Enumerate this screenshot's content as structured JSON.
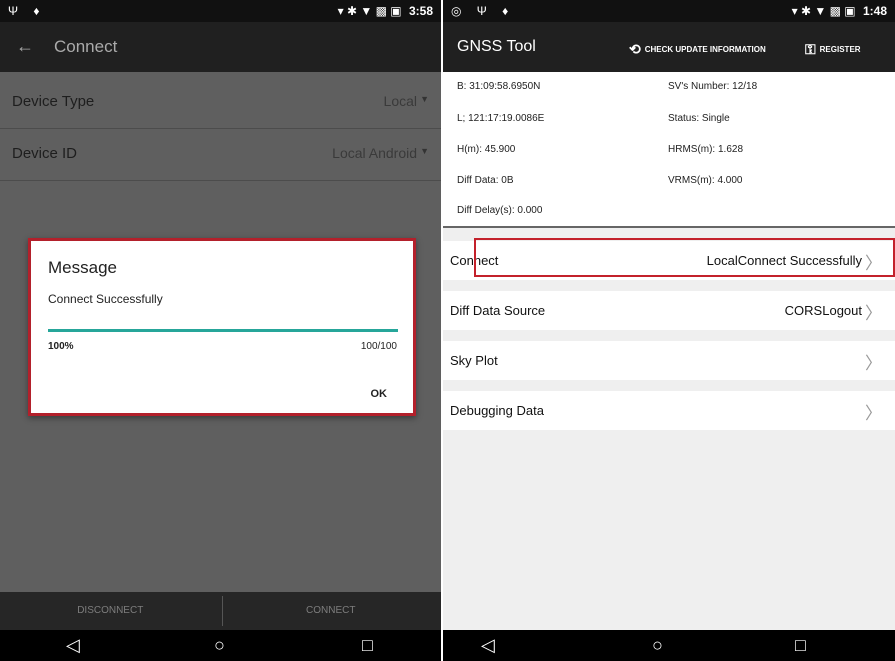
{
  "left": {
    "status_bar": {
      "left_icons": "Ψ ♦",
      "right_icons": "▾ ✱ ▼ ▩ ▣",
      "time": "3:58"
    },
    "app_bar": {
      "back_icon": "←",
      "title": "Connect"
    },
    "rows": [
      {
        "label": "Device Type",
        "value": "Local"
      },
      {
        "label": "Device ID",
        "value": "Local Android"
      }
    ],
    "dialog": {
      "title": "Message",
      "message": "Connect Successfully",
      "progress_fraction": 1.0,
      "percent": "100%",
      "count": "100/100",
      "ok_label": "OK"
    },
    "bottom_buttons": {
      "disconnect": "DISCONNECT",
      "connect": "CONNECT"
    }
  },
  "right": {
    "status_bar": {
      "left_icons": "◎ Ψ ♦",
      "right_icons": "▾ ✱ ▼ ▩ ▣",
      "time": "1:48"
    },
    "app_bar": {
      "title": "GNSS Tool",
      "check_update": "CHECK UPDATE INFORMATION",
      "register": "REGISTER"
    },
    "info": {
      "b": "B:   31:09:58.6950N",
      "l": "L;   121:17:19.0086E",
      "h": "H(m):   45.900",
      "diff_data": "Diff Data:  0B",
      "diff_delay": "Diff Delay(s):  0.000",
      "sv_number": "SV's Number:  12/18",
      "status": "Status:  Single",
      "hrms": "HRMS(m):  1.628",
      "vrms": "VRMS(m):  4.000"
    },
    "menu": [
      {
        "label": "Connect",
        "value": "LocalConnect Successfully"
      },
      {
        "label": "Diff Data Source",
        "value": "CORSLogout"
      },
      {
        "label": "Sky Plot",
        "value": ""
      },
      {
        "label": "Debugging Data",
        "value": ""
      }
    ]
  },
  "nav": {
    "back": "◁",
    "home": "○",
    "recents": "□"
  },
  "colors": {
    "accent": "#26a69a",
    "highlight": "#c3212b",
    "app_bar": "#202020"
  }
}
